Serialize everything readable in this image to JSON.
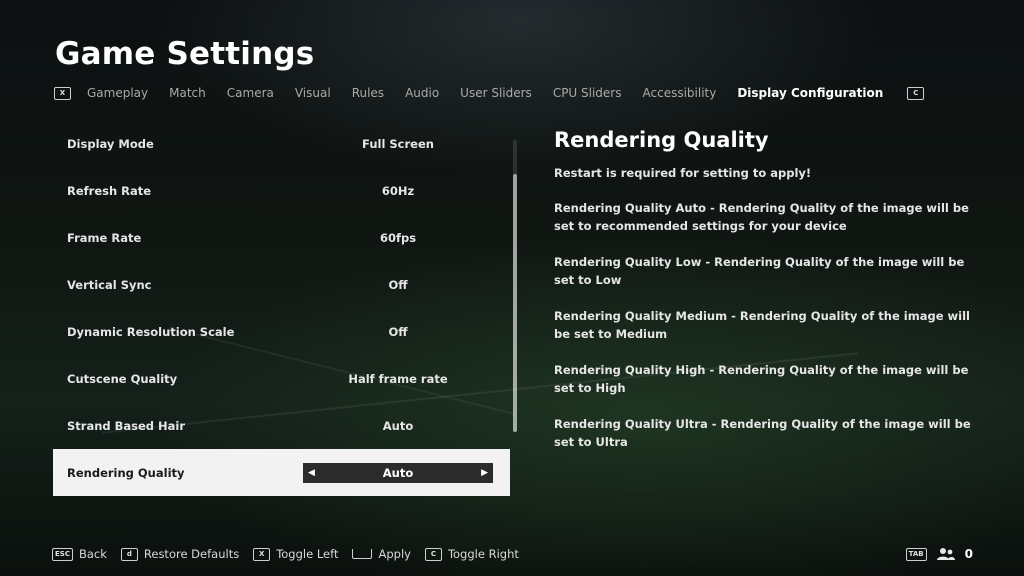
{
  "page": {
    "title": "Game Settings"
  },
  "tabs": {
    "left_key": "X",
    "right_key": "C",
    "items": [
      {
        "label": "Gameplay"
      },
      {
        "label": "Match"
      },
      {
        "label": "Camera"
      },
      {
        "label": "Visual"
      },
      {
        "label": "Rules"
      },
      {
        "label": "Audio"
      },
      {
        "label": "User Sliders"
      },
      {
        "label": "CPU Sliders"
      },
      {
        "label": "Accessibility"
      },
      {
        "label": "Display Configuration",
        "active": true
      }
    ]
  },
  "settings": [
    {
      "label": "Display Mode",
      "value": "Full Screen"
    },
    {
      "label": "Refresh Rate",
      "value": "60Hz"
    },
    {
      "label": "Frame Rate",
      "value": "60fps"
    },
    {
      "label": "Vertical Sync",
      "value": "Off"
    },
    {
      "label": "Dynamic Resolution Scale",
      "value": "Off"
    },
    {
      "label": "Cutscene Quality",
      "value": "Half frame rate"
    },
    {
      "label": "Strand Based Hair",
      "value": "Auto"
    },
    {
      "label": "Rendering Quality",
      "value": "Auto",
      "selected": true
    }
  ],
  "description": {
    "title": "Rendering Quality",
    "lines": [
      "Restart is required for setting to apply!",
      "Rendering Quality Auto - Rendering Quality of the image will be set to recommended settings for your device",
      "Rendering Quality Low - Rendering Quality of the image will be set to Low",
      "Rendering Quality Medium - Rendering Quality of the image will be set to Medium",
      "Rendering Quality High - Rendering Quality of the image will be set to High",
      "Rendering Quality Ultra - Rendering Quality of the image will be set to Ultra"
    ]
  },
  "footer": {
    "hints": [
      {
        "key": "ESC",
        "label": "Back"
      },
      {
        "key": "d",
        "label": "Restore Defaults"
      },
      {
        "key": "X",
        "label": "Toggle Left"
      },
      {
        "key": "",
        "label": "Apply"
      },
      {
        "key": "C",
        "label": "Toggle Right"
      }
    ],
    "tab_key": "TAB",
    "friends_icon": "people-icon",
    "friends_count": "0"
  },
  "colors": {
    "selected_row_bg": "#f2f2f2",
    "selector_bg": "#2b2b2b",
    "active_tab": "#ffffff",
    "inactive_tab": "#a8aaa8"
  }
}
